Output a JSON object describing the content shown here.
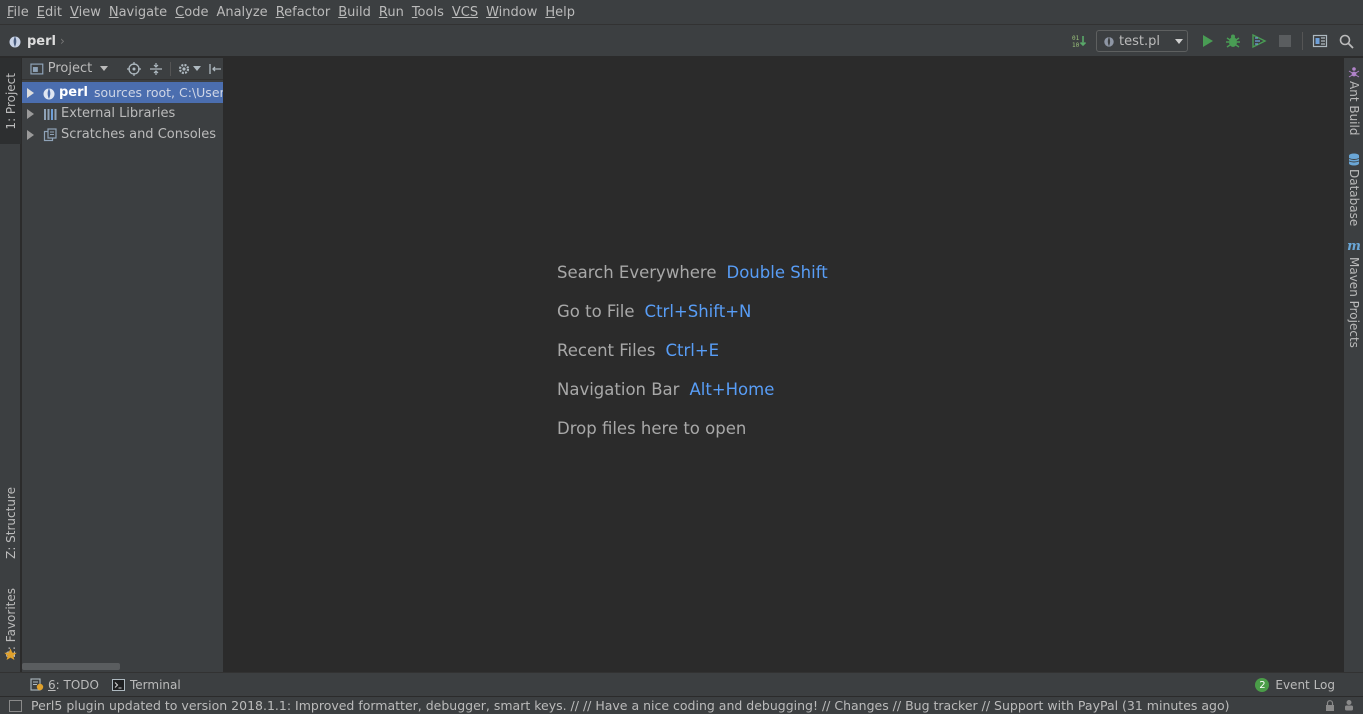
{
  "menu": [
    {
      "mnemonic": "F",
      "rest": "ile"
    },
    {
      "mnemonic": "E",
      "rest": "dit"
    },
    {
      "mnemonic": "V",
      "rest": "iew"
    },
    {
      "mnemonic": "N",
      "rest": "avigate"
    },
    {
      "mnemonic": "C",
      "rest": "ode"
    },
    {
      "mnemonic": "",
      "rest": "Analyze"
    },
    {
      "mnemonic": "R",
      "rest": "efactor"
    },
    {
      "mnemonic": "B",
      "rest": "uild"
    },
    {
      "mnemonic": "R",
      "rest": "un",
      "split": true
    },
    {
      "mnemonic": "T",
      "rest": "ools"
    },
    {
      "mnemonic": "",
      "rest": "VCS",
      "vcs": true
    },
    {
      "mnemonic": "W",
      "rest": "indow"
    },
    {
      "mnemonic": "H",
      "rest": "elp"
    }
  ],
  "navbar": {
    "breadcrumb": "perl",
    "run_config": "test.pl"
  },
  "left_tabs": {
    "project": "1: Project",
    "structure": "Z: Structure",
    "favorites": "2: Favorites"
  },
  "project_panel": {
    "title": "Project",
    "tree": [
      {
        "label": "perl",
        "hint": "sources root,  C:\\Users",
        "selected": true,
        "icon": "perl-module-icon"
      },
      {
        "label": "External Libraries",
        "hint": "",
        "selected": false,
        "icon": "libraries-icon"
      },
      {
        "label": "Scratches and Consoles",
        "hint": "",
        "selected": false,
        "icon": "scratches-icon"
      }
    ]
  },
  "editor_hints": [
    {
      "text": "Search Everywhere",
      "key": "Double Shift"
    },
    {
      "text": "Go to File",
      "key": "Ctrl+Shift+N"
    },
    {
      "text": "Recent Files",
      "key": "Ctrl+E"
    },
    {
      "text": "Navigation Bar",
      "key": "Alt+Home"
    },
    {
      "text": "Drop files here to open",
      "key": ""
    }
  ],
  "right_tabs": {
    "ant": "Ant Build",
    "database": "Database",
    "maven": "Maven Projects"
  },
  "bottom_tabs": {
    "todo_number": "6",
    "todo_label": ": TODO",
    "terminal": "Terminal",
    "event_log": "Event Log",
    "event_count": "2"
  },
  "status": {
    "message": "Perl5 plugin updated to version 2018.1.1: Improved formatter, debugger, smart keys. // // Have a nice coding and debugging! // Changes // Bug tracker // Support with PayPal (31 minutes ago)"
  },
  "colors": {
    "accent_blue": "#589df6",
    "selection": "#4b6eaf",
    "run_green": "#499c54"
  }
}
